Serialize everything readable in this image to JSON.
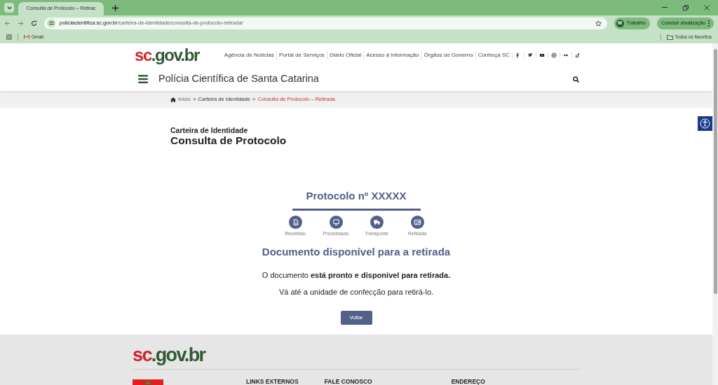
{
  "browser": {
    "tab": {
      "title": "Consulta de Protocolo – Retirac",
      "selected": true
    },
    "url_host": "policiacientifica.sc.gov.br",
    "url_path": "/carteira-de-identidade/consulta-de-protocolo-retirada/",
    "profile": {
      "initial": "M",
      "name": "Trabalho"
    },
    "update_button": "Concluir atualização",
    "bookmarks": [
      "Gmail"
    ],
    "all_bookmarks": "Todos os favoritos"
  },
  "header": {
    "logo": {
      "prefix": "sc",
      "suffix": ".gov.br"
    },
    "nav_links": [
      "Agência de Notícias",
      "Portal de Serviços",
      "Diário Oficial",
      "Acesso à Informação",
      "Órgãos do Governo",
      "Conheça SC"
    ],
    "social": [
      {
        "kind": "facebook"
      },
      {
        "kind": "twitter"
      },
      {
        "kind": "youtube"
      },
      {
        "kind": "instagram"
      },
      {
        "kind": "flickr"
      },
      {
        "kind": "tiktok"
      }
    ],
    "site_title": "Polícia Científica de Santa Catarina"
  },
  "breadcrumb": {
    "separator": ">",
    "items": [
      {
        "label": "Início",
        "current": false
      },
      {
        "label": "Carteira de Identidade",
        "current": false
      },
      {
        "label": "Consulta de Protocolo – Retirada",
        "current": true
      }
    ]
  },
  "page": {
    "kicker": "Carteira de Identidade",
    "title": "Consulta de Protocolo"
  },
  "protocol": {
    "title": "Protocolo nº XXXXX",
    "steps": [
      {
        "kind": "document",
        "label": "Recebido",
        "completed": true
      },
      {
        "kind": "monitor",
        "label": "Processado",
        "completed": true
      },
      {
        "kind": "truck",
        "label": "Transporte",
        "completed": true
      },
      {
        "kind": "card",
        "label": "Retirada",
        "completed": true
      }
    ],
    "status_title": "Documento disponível para a retirada",
    "message": "O documento **está pronto e disponível para retirada.**",
    "instruction": "Vá até a unidade de confecção para retirá-lo.",
    "button": "Voltar"
  },
  "footer": {
    "logo": {
      "prefix": "sc",
      "suffix": ".gov.br"
    },
    "columns": [
      "LINKS EXTERNOS",
      "FALE CONOSCO",
      "ENDEREÇO"
    ]
  }
}
